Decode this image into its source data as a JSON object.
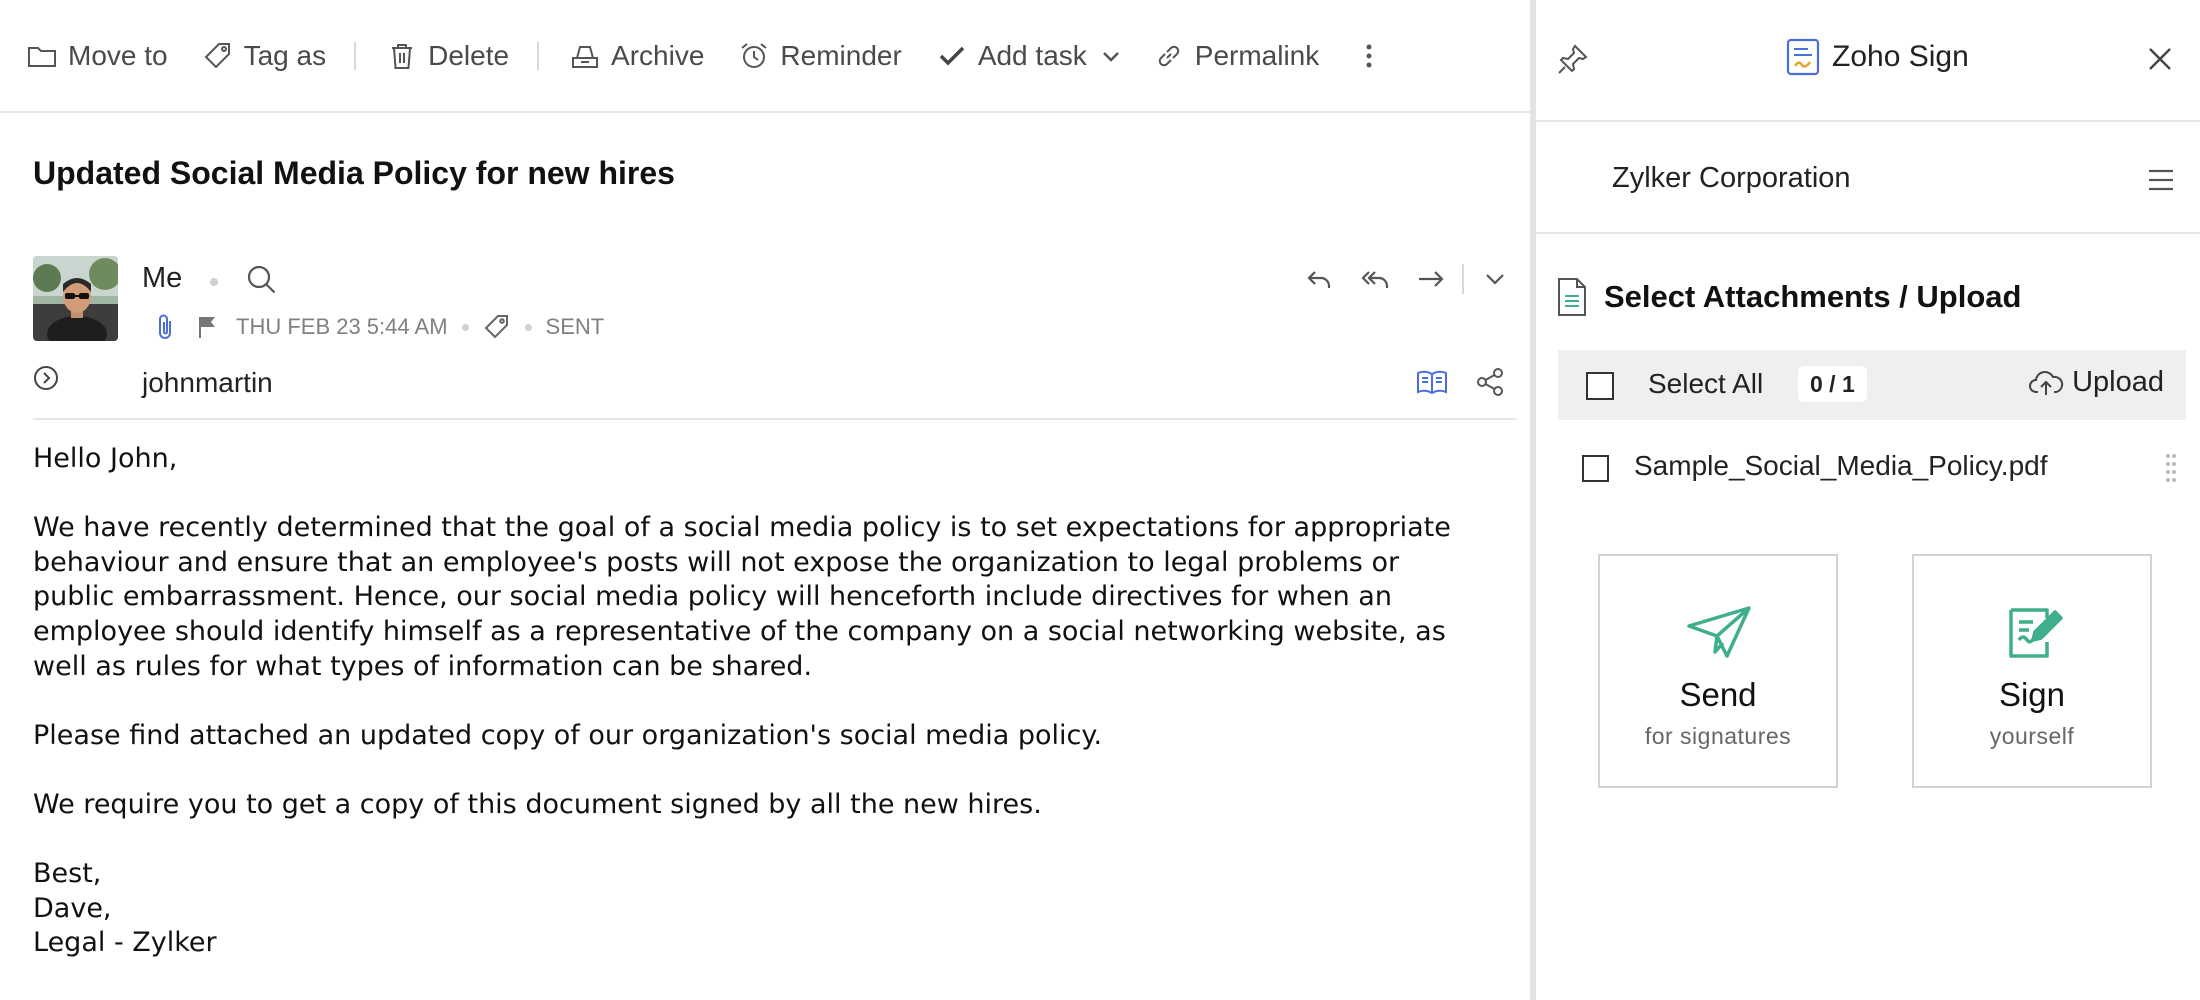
{
  "toolbar": {
    "move_to": "Move to",
    "tag_as": "Tag as",
    "delete": "Delete",
    "archive": "Archive",
    "reminder": "Reminder",
    "add_task": "Add task",
    "permalink": "Permalink"
  },
  "email": {
    "subject": "Updated Social Media Policy for new hires",
    "sender": "Me",
    "date": "THU FEB 23 5:44 AM",
    "status": "SENT",
    "to": "johnmartin",
    "body": {
      "greeting": "Hello John,",
      "paragraph1_lines": [
        "We have recently determined that the goal of a social media policy is to set expectations for appropriate",
        "behaviour and ensure that an employee's posts will not expose the organization to legal problems or",
        "public embarrassment. Hence, our social media policy will henceforth include directives for when an",
        "employee should identify himself as a representative of the company on a social networking website, as",
        "well as rules for what types of information can be shared."
      ],
      "paragraph2": "Please find attached an updated copy of our organization's social media policy.",
      "paragraph3": "We require you to get a copy of this document signed by all the new hires.",
      "signature": [
        "Best,",
        "Dave,",
        "Legal - Zylker"
      ]
    }
  },
  "panel": {
    "app_title": "Zoho Sign",
    "org_name": "Zylker Corporation",
    "section_title": "Select Attachments / Upload",
    "select_all": "Select All",
    "count": "0 / 1",
    "upload": "Upload",
    "attachment_name": "Sample_Social_Media_Policy.pdf",
    "send_card": {
      "title": "Send",
      "subtitle": "for signatures"
    },
    "sign_card": {
      "title": "Sign",
      "subtitle": "yourself"
    }
  },
  "colors": {
    "accent_green": "#3fae8c",
    "link_blue": "#4a6fd8"
  },
  "icons": [
    "folder-icon",
    "tag-icon",
    "trash-icon",
    "archive-icon",
    "alarm-clock-icon",
    "checkmark-icon",
    "chevron-down-icon",
    "link-icon",
    "more-vertical-icon",
    "search-icon",
    "paperclip-icon",
    "flag-icon",
    "reply-icon",
    "reply-all-icon",
    "forward-icon",
    "expand-circle-icon",
    "reader-icon",
    "share-icon",
    "pin-icon",
    "zoho-sign-logo-icon",
    "close-icon",
    "hamburger-menu-icon",
    "file-icon",
    "cloud-upload-icon",
    "drag-handle-icon",
    "paper-plane-icon",
    "sign-pen-icon"
  ]
}
